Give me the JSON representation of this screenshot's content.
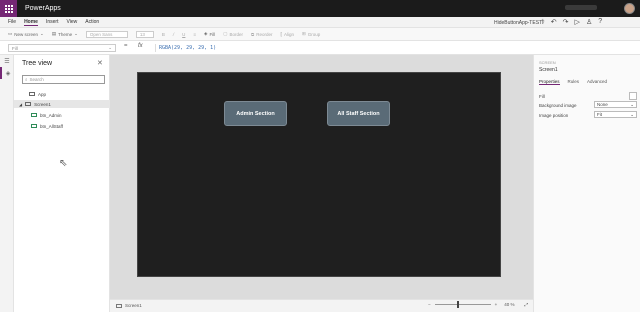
{
  "titlebar": {
    "app_name": "PowerApps",
    "waffle_icon": "app-launcher-icon",
    "accent": "#742774"
  },
  "menu": {
    "items": [
      "File",
      "Home",
      "Insert",
      "View",
      "Action"
    ],
    "active": "Home",
    "app_title": "HideButtonApp-TEST",
    "icons": [
      "stethoscope-icon",
      "undo-icon",
      "redo-icon",
      "play-icon",
      "person-icon",
      "help-icon"
    ]
  },
  "toolbar": {
    "new_screen": "New screen",
    "theme": "Theme",
    "font": "Open Sans",
    "size": "13",
    "fill": "Fill",
    "border": "Border",
    "reorder": "Reorder",
    "align": "Align",
    "group": "Group"
  },
  "formula": {
    "property": "Fill",
    "equals": "=",
    "fx": "fx",
    "value": "RGBA(29, 29, 29, 1)"
  },
  "treeview": {
    "title": "Tree view",
    "search_placeholder": "Search",
    "app_label": "App",
    "screen_label": "Screen1",
    "controls": [
      "btn_Admin",
      "btn_AllStaff"
    ]
  },
  "canvas": {
    "background": "#1f1f1f",
    "buttons": [
      "Admin Section",
      "All Staff Section"
    ],
    "button_color": "#5a6b77"
  },
  "statusbar": {
    "screen_label": "Screen1",
    "zoom_minus": "−",
    "zoom_plus": "+",
    "zoom_value": "40 %",
    "zoom_level_fraction": 0.4
  },
  "properties": {
    "kind": "SCREEN",
    "name": "Screen1",
    "tabs": [
      "Properties",
      "Rules",
      "Advanced"
    ],
    "active_tab": "Properties",
    "fill_label": "Fill",
    "background_image_label": "Background image",
    "background_image_value": "None",
    "image_position_label": "Image position",
    "image_position_value": "Fit"
  }
}
